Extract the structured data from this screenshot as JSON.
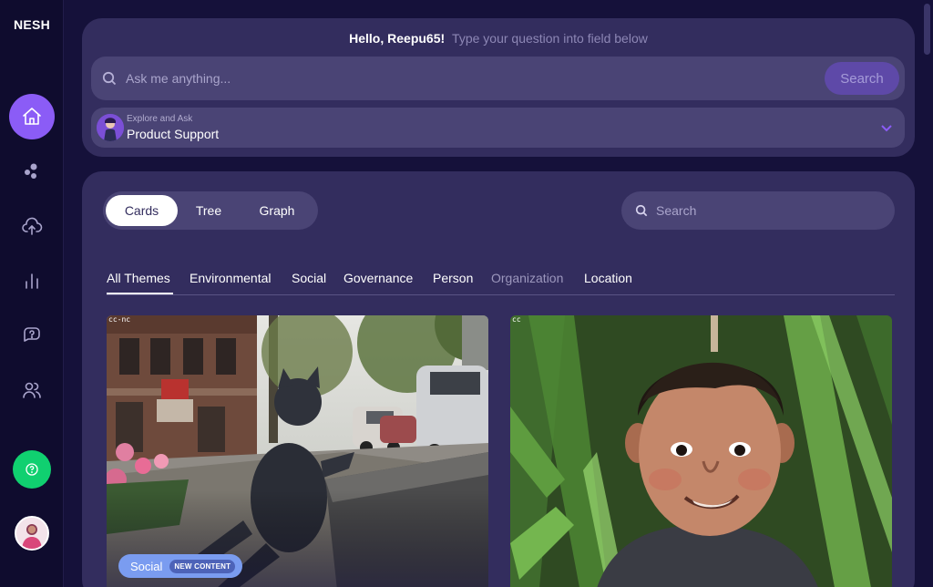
{
  "app": {
    "logo": "NESH"
  },
  "sidebar": {
    "items": [
      {
        "name": "home",
        "icon": "home-icon",
        "active": true
      },
      {
        "name": "clusters",
        "icon": "circles-icon",
        "active": false
      },
      {
        "name": "upload",
        "icon": "cloud-upload-icon",
        "active": false
      },
      {
        "name": "analytics",
        "icon": "bar-chart-icon",
        "active": false
      },
      {
        "name": "questions",
        "icon": "chat-question-icon",
        "active": false
      },
      {
        "name": "users",
        "icon": "users-icon",
        "active": false
      }
    ],
    "help_icon": "help-icon"
  },
  "header": {
    "greeting_name": "Hello, Reepu65!",
    "greeting_hint": "Type your question into field below",
    "ask_placeholder": "Ask me anything...",
    "ask_button": "Search",
    "assistant_caption": "Explore and Ask",
    "assistant_name": "Product Support"
  },
  "main": {
    "views": [
      {
        "label": "Cards",
        "active": true
      },
      {
        "label": "Tree",
        "active": false
      },
      {
        "label": "Graph",
        "active": false
      }
    ],
    "search_placeholder": "Search",
    "themes": [
      {
        "label": "All Themes",
        "active": true
      },
      {
        "label": "Environmental",
        "active": false
      },
      {
        "label": "Social",
        "active": false
      },
      {
        "label": "Governance",
        "active": false
      },
      {
        "label": "Person",
        "active": false
      },
      {
        "label": "Organization",
        "active": false,
        "muted": true
      },
      {
        "label": "Location",
        "active": false
      }
    ],
    "cards": [
      {
        "license": "cc-nc",
        "tag": "Social",
        "badge": "NEW CONTENT"
      },
      {
        "license": "cc"
      }
    ]
  },
  "colors": {
    "accent": "#8b5cf6",
    "help": "#10d070",
    "background": "#15113a",
    "panel": "#332d5e"
  }
}
